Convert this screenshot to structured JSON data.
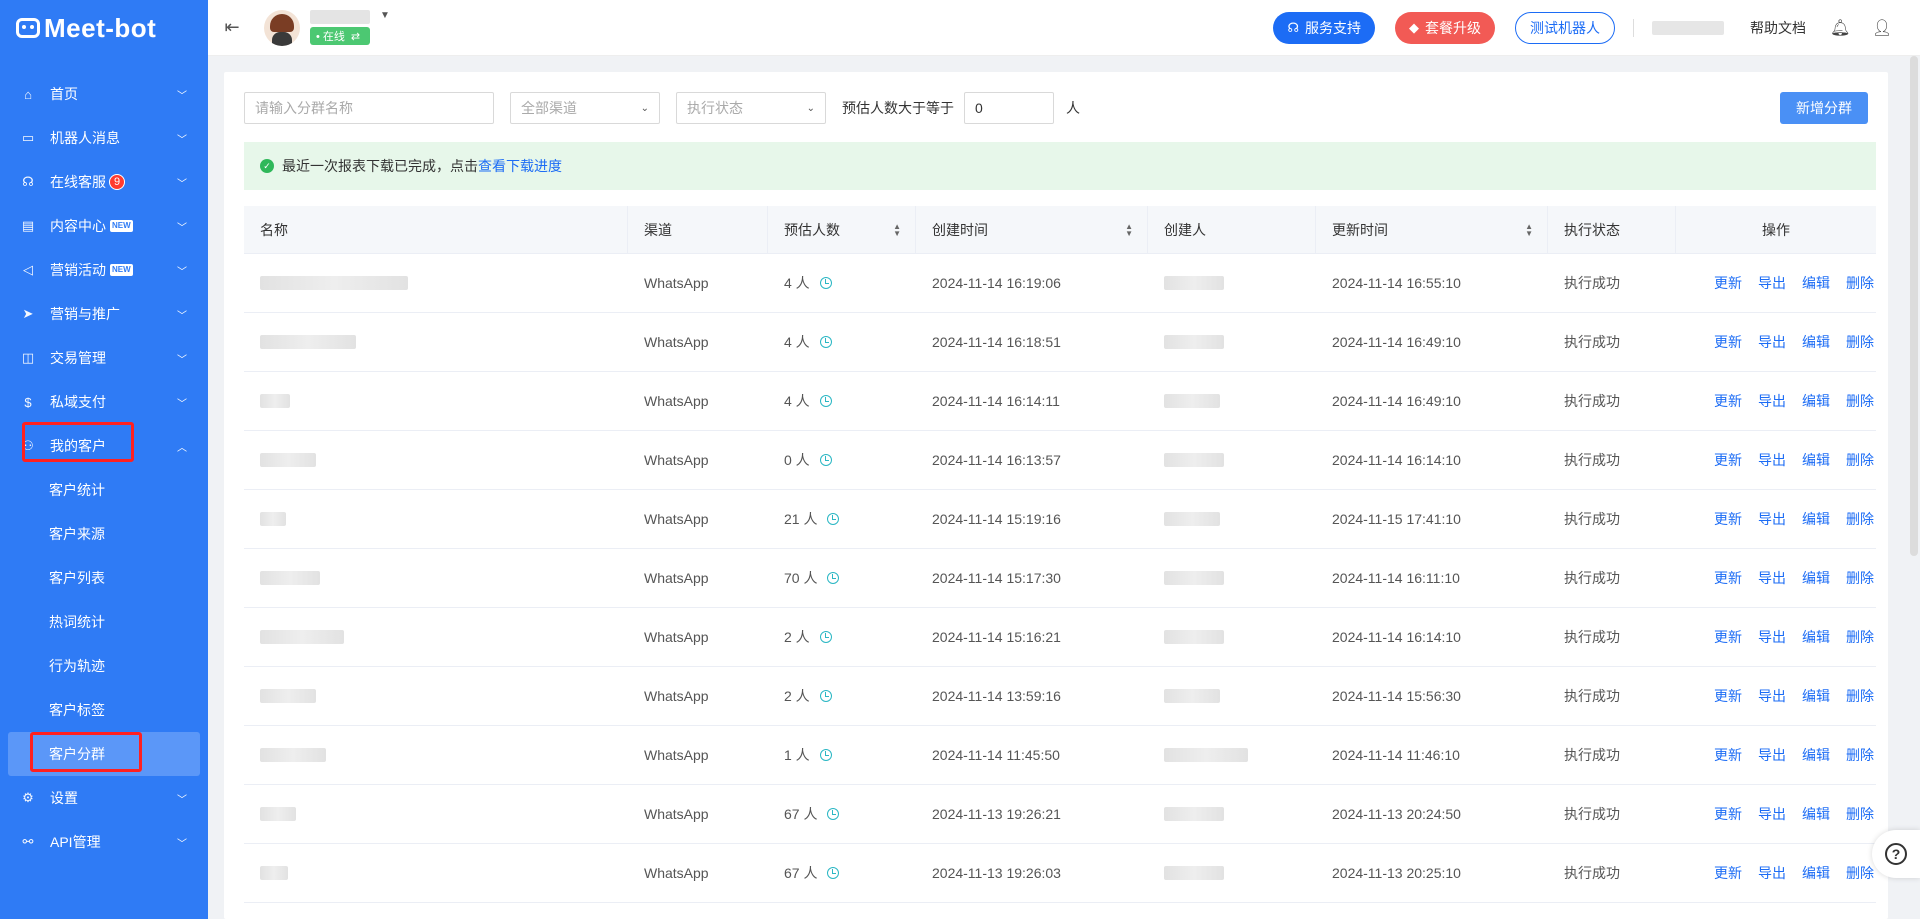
{
  "brand": {
    "name": "Meet-bot"
  },
  "sidebar": {
    "items": [
      {
        "label": "首页",
        "icon": "home-icon"
      },
      {
        "label": "机器人消息",
        "icon": "robot-message-icon"
      },
      {
        "label": "在线客服",
        "icon": "headset-icon",
        "badge": "9"
      },
      {
        "label": "内容中心",
        "icon": "content-icon",
        "new": "NEW"
      },
      {
        "label": "营销活动",
        "icon": "megaphone-icon",
        "new": "NEW"
      },
      {
        "label": "营销与推广",
        "icon": "send-icon"
      },
      {
        "label": "交易管理",
        "icon": "bag-icon"
      },
      {
        "label": "私域支付",
        "icon": "coin-icon"
      },
      {
        "label": "我的客户",
        "icon": "customer-icon"
      }
    ],
    "sub_items": [
      "客户统计",
      "客户来源",
      "客户列表",
      "热词统计",
      "行为轨迹",
      "客户标签",
      "客户分群"
    ],
    "bottom_items": [
      {
        "label": "设置",
        "icon": "settings-icon"
      },
      {
        "label": "API管理",
        "icon": "api-icon"
      }
    ]
  },
  "topbar": {
    "status": "• 在线",
    "support": "服务支持",
    "upgrade": "套餐升级",
    "test_bot": "测试机器人",
    "help_docs": "帮助文档"
  },
  "filters": {
    "name_placeholder": "请输入分群名称",
    "channel": "全部渠道",
    "status": "执行状态",
    "estimate_label": "预估人数大于等于",
    "estimate_value": "0",
    "unit": "人",
    "add_button": "新增分群"
  },
  "alert": {
    "text": "最近一次报表下载已完成，点击",
    "link": "查看下载进度"
  },
  "table": {
    "headers": [
      "名称",
      "渠道",
      "预估人数",
      "创建时间",
      "创建人",
      "更新时间",
      "执行状态",
      "操作"
    ],
    "ops": [
      "更新",
      "导出",
      "编辑",
      "删除"
    ],
    "rows": [
      {
        "channel": "WhatsApp",
        "count": "4 人",
        "created": "2024-11-14 16:19:06",
        "updated": "2024-11-14 16:55:10",
        "status": "执行成功"
      },
      {
        "channel": "WhatsApp",
        "count": "4 人",
        "created": "2024-11-14 16:18:51",
        "updated": "2024-11-14 16:49:10",
        "status": "执行成功"
      },
      {
        "channel": "WhatsApp",
        "count": "4 人",
        "created": "2024-11-14 16:14:11",
        "updated": "2024-11-14 16:49:10",
        "status": "执行成功"
      },
      {
        "channel": "WhatsApp",
        "count": "0 人",
        "created": "2024-11-14 16:13:57",
        "updated": "2024-11-14 16:14:10",
        "status": "执行成功"
      },
      {
        "channel": "WhatsApp",
        "count": "21 人",
        "created": "2024-11-14 15:19:16",
        "updated": "2024-11-15 17:41:10",
        "status": "执行成功"
      },
      {
        "channel": "WhatsApp",
        "count": "70 人",
        "created": "2024-11-14 15:17:30",
        "updated": "2024-11-14 16:11:10",
        "status": "执行成功"
      },
      {
        "channel": "WhatsApp",
        "count": "2 人",
        "created": "2024-11-14 15:16:21",
        "updated": "2024-11-14 16:14:10",
        "status": "执行成功"
      },
      {
        "channel": "WhatsApp",
        "count": "2 人",
        "created": "2024-11-14 13:59:16",
        "updated": "2024-11-14 15:56:30",
        "status": "执行成功"
      },
      {
        "channel": "WhatsApp",
        "count": "1 人",
        "created": "2024-11-14 11:45:50",
        "updated": "2024-11-14 11:46:10",
        "status": "执行成功"
      },
      {
        "channel": "WhatsApp",
        "count": "67 人",
        "created": "2024-11-13 19:26:21",
        "updated": "2024-11-13 20:24:50",
        "status": "执行成功"
      },
      {
        "channel": "WhatsApp",
        "count": "67 人",
        "created": "2024-11-13 19:26:03",
        "updated": "2024-11-13 20:25:10",
        "status": "执行成功"
      }
    ]
  },
  "colors": {
    "sidebar": "#2f7bf5",
    "primary": "#1c6cf5",
    "danger": "#f25a55",
    "success": "#2fb85a",
    "highlight": "#ff2020"
  }
}
